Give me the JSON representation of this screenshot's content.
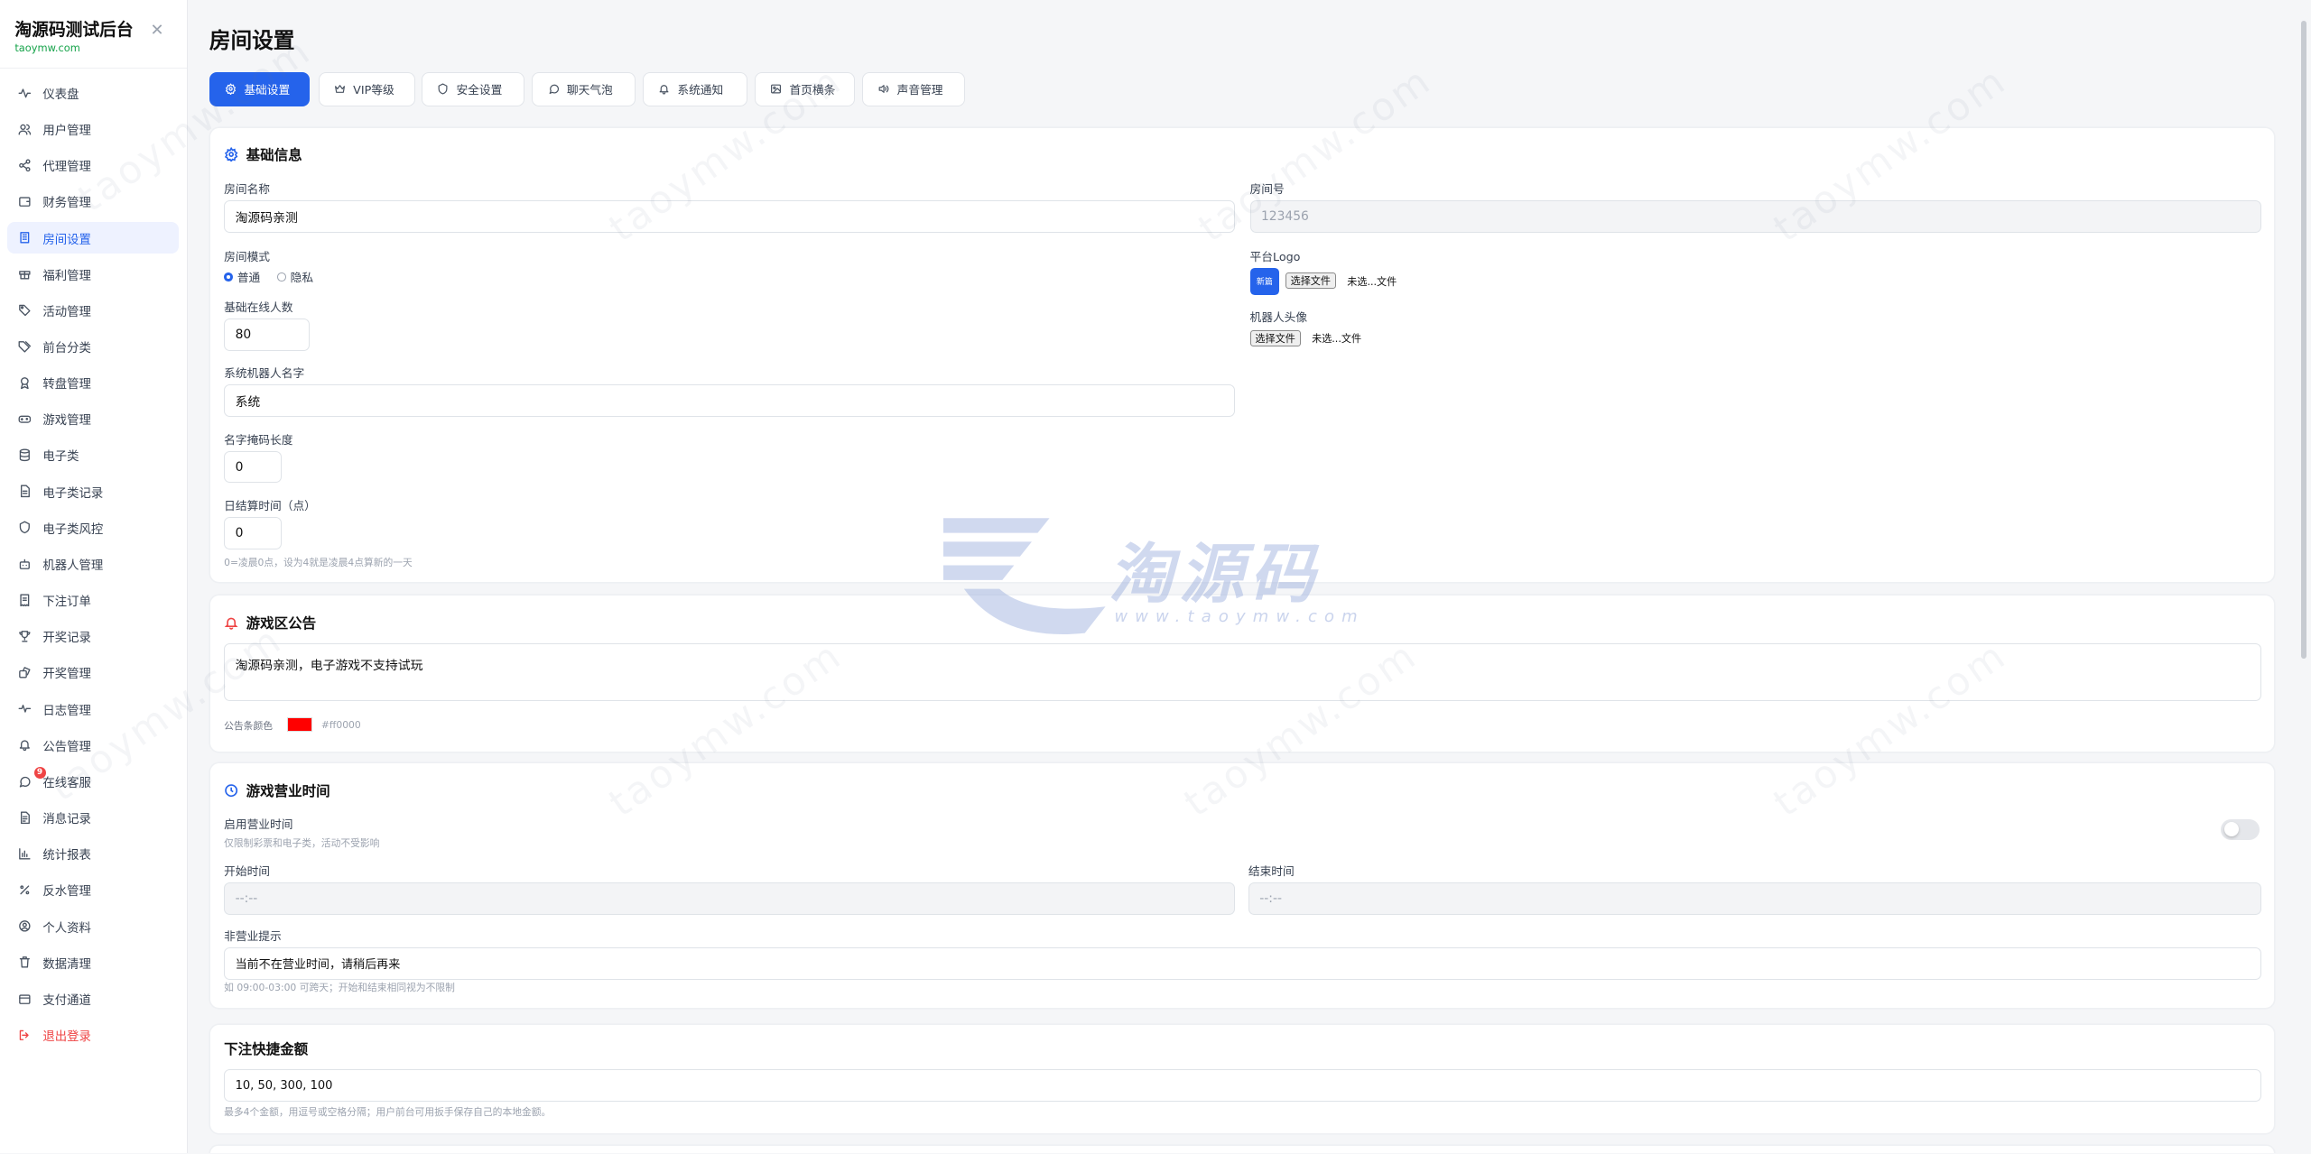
{
  "brand": {
    "title": "淘源码测试后台",
    "subtitle": "taoymw.com"
  },
  "sidebar": {
    "items": [
      {
        "label": "仪表盘",
        "icon": "activity-icon"
      },
      {
        "label": "用户管理",
        "icon": "users-icon"
      },
      {
        "label": "代理管理",
        "icon": "share-icon"
      },
      {
        "label": "财务管理",
        "icon": "wallet-icon"
      },
      {
        "label": "房间设置",
        "icon": "building-icon",
        "active": true
      },
      {
        "label": "福利管理",
        "icon": "gift-icon"
      },
      {
        "label": "活动管理",
        "icon": "tag-icon"
      },
      {
        "label": "前台分类",
        "icon": "tags-icon"
      },
      {
        "label": "转盘管理",
        "icon": "award-icon"
      },
      {
        "label": "游戏管理",
        "icon": "gamepad-icon"
      },
      {
        "label": "电子类",
        "icon": "database-icon"
      },
      {
        "label": "电子类记录",
        "icon": "file-icon"
      },
      {
        "label": "电子类风控",
        "icon": "shield-icon"
      },
      {
        "label": "机器人管理",
        "icon": "bot-icon"
      },
      {
        "label": "下注订单",
        "icon": "receipt-icon"
      },
      {
        "label": "开奖记录",
        "icon": "trophy-icon"
      },
      {
        "label": "开奖管理",
        "icon": "dice-icon"
      },
      {
        "label": "日志管理",
        "icon": "pulse-icon"
      },
      {
        "label": "公告管理",
        "icon": "bell-icon"
      },
      {
        "label": "在线客服",
        "icon": "chat-icon",
        "badge": "9"
      },
      {
        "label": "消息记录",
        "icon": "message-file-icon"
      },
      {
        "label": "统计报表",
        "icon": "chart-icon"
      },
      {
        "label": "反水管理",
        "icon": "percent-icon"
      },
      {
        "label": "个人资料",
        "icon": "user-circle-icon"
      },
      {
        "label": "数据清理",
        "icon": "trash-icon"
      },
      {
        "label": "支付通道",
        "icon": "card-icon"
      },
      {
        "label": "退出登录",
        "icon": "logout-icon",
        "logout": true
      }
    ]
  },
  "page": {
    "title": "房间设置"
  },
  "tabs": [
    {
      "label": "基础设置",
      "icon": "gear-icon",
      "active": true
    },
    {
      "label": "VIP等级",
      "icon": "crown-icon"
    },
    {
      "label": "安全设置",
      "icon": "shield-icon"
    },
    {
      "label": "聊天气泡",
      "icon": "chat-icon"
    },
    {
      "label": "系统通知",
      "icon": "bell-icon"
    },
    {
      "label": "首页横条",
      "icon": "image-icon"
    },
    {
      "label": "声音管理",
      "icon": "volume-icon"
    }
  ],
  "basic": {
    "title": "基础信息",
    "room_name_label": "房间名称",
    "room_name_value": "淘源码亲测",
    "room_no_label": "房间号",
    "room_no_value": "123456",
    "mode_label": "房间模式",
    "mode_options": [
      "普通",
      "隐私"
    ],
    "mode_selected": "普通",
    "logo_label": "平台Logo",
    "logo_thumb": "新篇",
    "choose_file": "选择文件",
    "no_file": "未选...文件",
    "robot_avatar_label": "机器人头像",
    "online_label": "基础在线人数",
    "online_value": "80",
    "robot_name_label": "系统机器人名字",
    "robot_name_value": "系统",
    "mask_label": "名字掩码长度",
    "mask_value": "0",
    "settle_label": "日结算时间（点）",
    "settle_value": "0",
    "settle_hint": "0=凌晨0点，设为4就是凌晨4点算新的一天"
  },
  "notice": {
    "title": "游戏区公告",
    "content": "淘源码亲测，电子游戏不支持试玩",
    "color_label": "公告条颜色",
    "color_value": "#ff0000"
  },
  "hours": {
    "title": "游戏营业时间",
    "enable_label": "启用营业时间",
    "enable_hint": "仅限制彩票和电子类，活动不受影响",
    "enabled": false,
    "start_label": "开始时间",
    "start_placeholder": "--:--",
    "end_label": "结束时间",
    "end_placeholder": "--:--",
    "closed_label": "非营业提示",
    "closed_value": "当前不在营业时间，请稍后再来",
    "closed_hint": "如 09:00-03:00 可跨天；开始和结束相同视为不限制"
  },
  "quick": {
    "title": "下注快捷金额",
    "value": "10, 50, 300, 100",
    "hint": "最多4个金额，用逗号或空格分隔；用户前台可用扳手保存自己的本地金额。"
  },
  "watermark": {
    "brand": "淘源码",
    "url": "www.taoymw.com",
    "tile": "taoymw.com"
  },
  "colors": {
    "accent": "#2563eb",
    "logout": "#ef4444",
    "notice_color": "#ff0000"
  }
}
